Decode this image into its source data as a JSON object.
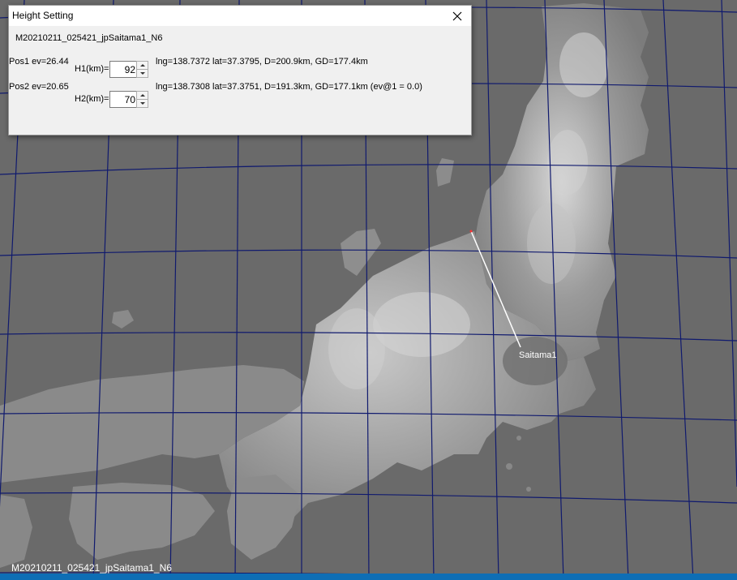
{
  "dialog": {
    "title": "Height Setting",
    "session_name": "M20210211_025421_jpSaitama1_N6",
    "pos1": {
      "label": "Pos1 ev=26.44",
      "height_label": "H1(km)=",
      "height_value": "92",
      "info": "lng=138.7372 lat=37.3795, D=200.9km, GD=177.4km"
    },
    "pos2": {
      "label": "Pos2 ev=20.65",
      "height_label": "H2(km)=",
      "height_value": "70",
      "info": "lng=138.7308 lat=37.3751, D=191.3km, GD=177.1km  (ev@1 = 0.0)"
    },
    "close_icon": "close-icon"
  },
  "map": {
    "station_label": "Saitama1",
    "footer_label": "M20210211_025421_jpSaitama1_N6",
    "colors": {
      "sea": "#6a6a6a",
      "grid": "#101a6e",
      "track": "#ffffff",
      "taskbar": "#0e6eb5"
    }
  }
}
